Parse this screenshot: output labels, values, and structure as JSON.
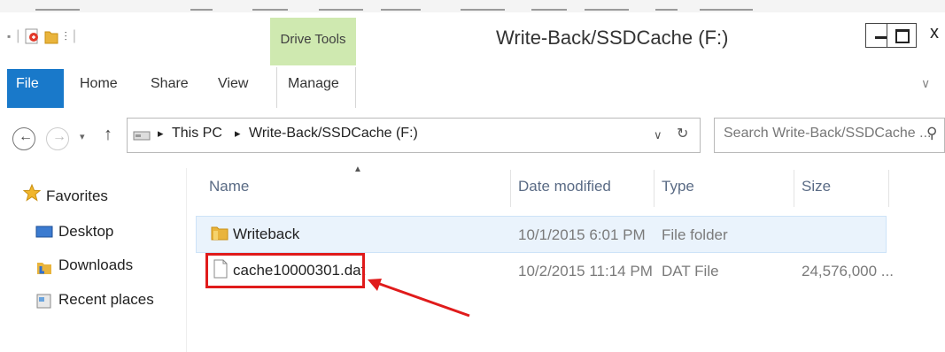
{
  "window": {
    "title": "Write-Back/SSDCache (F:)",
    "contextual_tab": "Drive Tools",
    "minimize": "–",
    "maximize": "□",
    "close": "x"
  },
  "ribbon": {
    "tabs": [
      "File",
      "Home",
      "Share",
      "View",
      "Manage"
    ],
    "expand_icon": "chevron-down-icon"
  },
  "address": {
    "crumbs": [
      "This PC",
      "Write-Back/SSDCache (F:)"
    ],
    "dropdown": "∨",
    "refresh": "↻"
  },
  "search": {
    "placeholder": "Search Write-Back/SSDCache ..."
  },
  "navigation_pane": {
    "favorites_label": "Favorites",
    "items": [
      "Desktop",
      "Downloads",
      "Recent places"
    ]
  },
  "file_list": {
    "columns": [
      "Name",
      "Date modified",
      "Type",
      "Size"
    ],
    "rows": [
      {
        "name": "Writeback",
        "date": "10/1/2015 6:01 PM",
        "type": "File folder",
        "size": "",
        "icon": "folder-icon"
      },
      {
        "name": "cache10000301.dat",
        "date": "10/2/2015 11:14 PM",
        "type": "DAT File",
        "size": "24,576,000 ...",
        "icon": "file-icon"
      }
    ]
  },
  "annotation": {
    "color": "#e01b1b"
  }
}
